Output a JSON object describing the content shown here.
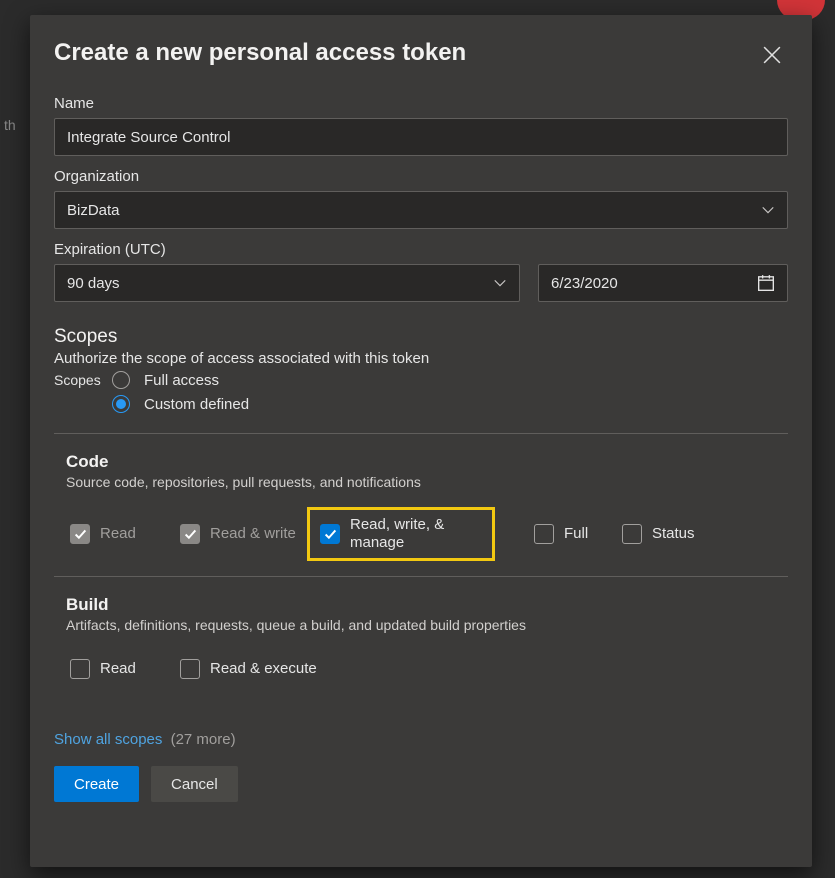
{
  "backdrop_fragment": "th",
  "modal": {
    "title": "Create a new personal access token",
    "name_label": "Name",
    "name_value": "Integrate Source Control",
    "org_label": "Organization",
    "org_value": "BizData",
    "expiration_label": "Expiration (UTC)",
    "expiration_preset": "90 days",
    "expiration_date": "6/23/2020"
  },
  "scopes": {
    "title": "Scopes",
    "description": "Authorize the scope of access associated with this token",
    "label": "Scopes",
    "option_full": "Full access",
    "option_custom": "Custom defined",
    "selected": "custom"
  },
  "groups": [
    {
      "title": "Code",
      "desc": "Source code, repositories, pull requests, and notifications",
      "perms": [
        {
          "label": "Read",
          "state": "gray"
        },
        {
          "label": "Read & write",
          "state": "gray"
        },
        {
          "label": "Read, write, & manage",
          "state": "blue",
          "highlight": true
        },
        {
          "label": "Full",
          "state": "empty"
        },
        {
          "label": "Status",
          "state": "empty"
        }
      ]
    },
    {
      "title": "Build",
      "desc": "Artifacts, definitions, requests, queue a build, and updated build properties",
      "perms": [
        {
          "label": "Read",
          "state": "empty"
        },
        {
          "label": "Read & execute",
          "state": "empty"
        }
      ]
    }
  ],
  "footer": {
    "show_all": "Show all scopes",
    "more_count": "(27 more)",
    "create": "Create",
    "cancel": "Cancel"
  }
}
